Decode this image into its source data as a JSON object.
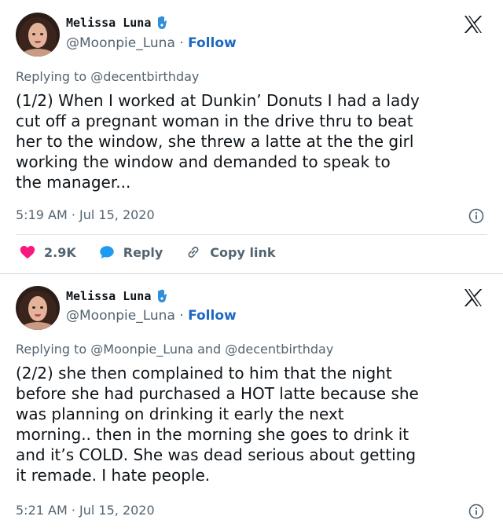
{
  "tweets": [
    {
      "author_name": "Melissa Luna",
      "handle": "@Moonpie_Luna",
      "separator": "·",
      "follow_label": "Follow",
      "replying_to": "Replying to @decentbirthday",
      "lines": [
        "(1/2) When I worked at Dunkin’ Donuts I had a lady",
        "cut off a pregnant woman in the drive thru to beat",
        "her to the window, she threw a latte at the the girl",
        "working the window and demanded to speak to",
        "the manager..."
      ],
      "timestamp": "5:19 AM · Jul 15, 2020",
      "actions": {
        "like_count": "2.9K",
        "reply_label": "Reply",
        "copy_link_label": "Copy link"
      }
    },
    {
      "author_name": "Melissa Luna",
      "handle": "@Moonpie_Luna",
      "separator": "·",
      "follow_label": "Follow",
      "replying_to": "Replying to @Moonpie_Luna and @decentbirthday",
      "lines": [
        "(2/2) she then complained to him that the night",
        "before she had purchased a HOT latte because she",
        "was planning on drinking it early the next",
        "morning.. then in the morning she goes to drink it",
        "and it’s COLD. She was dead serious about getting",
        "it remade. I hate people."
      ],
      "timestamp": "5:21 AM · Jul 15, 2020"
    }
  ],
  "colors": {
    "text": "#0f1419",
    "secondary": "#536471",
    "follow_blue": "#1d68c2",
    "like_red": "#f91880",
    "reply_blue": "#1d9bf0"
  },
  "icons": [
    "hamsa-icon",
    "x-logo-icon",
    "info-icon",
    "heart-icon",
    "reply-bubble-icon",
    "link-icon"
  ]
}
